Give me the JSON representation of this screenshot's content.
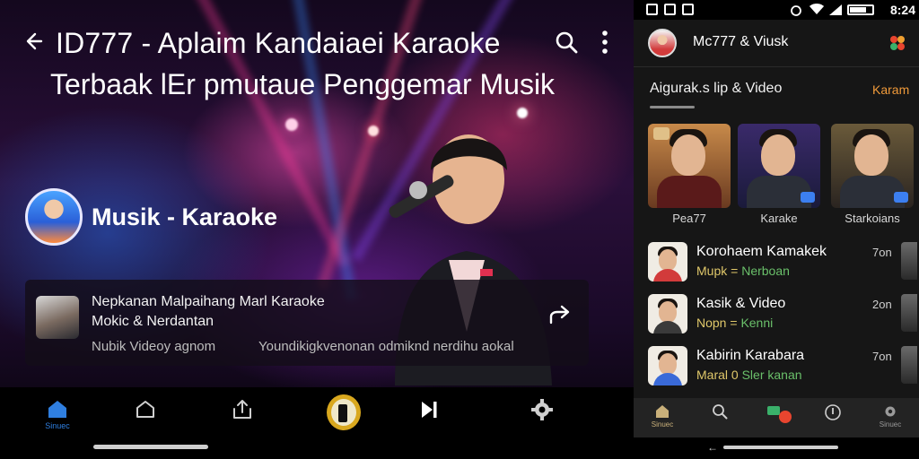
{
  "header": {
    "title_line1": "ID777 - Aplaim Kandaiaei Karaoke",
    "title_line2": "Terbaak lEr pmutaue Penggemar Musik"
  },
  "artist": {
    "name": "Musik - Karaoke"
  },
  "now_playing": {
    "line1": "Nepkanan Malpaihang Marl Karaoke",
    "line2": "Mokic & Nerdantan",
    "line3": "Nubik Videoy agnom",
    "line4": "Youndikigkvenonan odmiknd nerdihu aokal"
  },
  "left_nav": {
    "home_label": "Sinuec",
    "items": [
      "home-outline",
      "upload",
      "play",
      "skip-next",
      "settings"
    ]
  },
  "status_bar": {
    "time": "8:24"
  },
  "right_header": {
    "title": "Mc777 & Viusk"
  },
  "section": {
    "title": "Aigurak.s lip & Video",
    "more": "Karam"
  },
  "thumbnails": [
    {
      "label": "Pea77"
    },
    {
      "label": "Karake"
    },
    {
      "label": "Starkoians"
    }
  ],
  "list_items": [
    {
      "title": "Korohaem Kamakek",
      "sub_a": "Mupk",
      "sub_sep": "=",
      "sub_b": "Nerboan",
      "time": "7on"
    },
    {
      "title": "Kasik & Video",
      "sub_a": "Nopn",
      "sub_sep": "=",
      "sub_b": "Kenni",
      "time": "2on"
    },
    {
      "title": "Kabirin Karabara",
      "sub_a": "Maral",
      "sub_sep": "0",
      "sub_b": "Sler kanan",
      "time": "7on"
    }
  ],
  "right_nav": {
    "home_label": "Sinuec",
    "last_label": "Sinuec"
  },
  "colors": {
    "accent_orange": "#f09a3a",
    "nav_blue": "#2f7fe0",
    "gold": "#d9a81e"
  }
}
